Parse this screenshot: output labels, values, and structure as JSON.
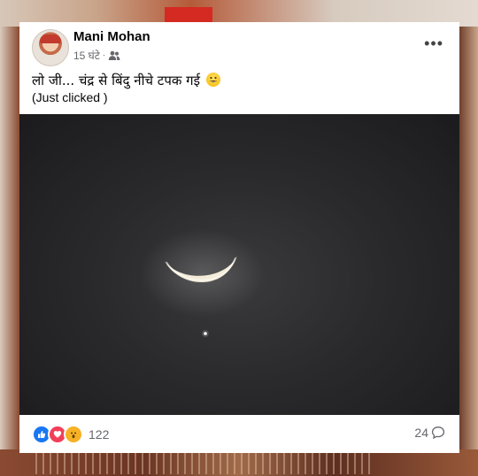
{
  "post": {
    "author": "Mani Mohan",
    "time": "15 घंटे",
    "separator": "·",
    "text": "लो जी... चंद्र से बिंदु नीचे टपक गई",
    "subtext": "(Just clicked )",
    "more_label": "•••"
  },
  "footer": {
    "reaction_count": "122",
    "comment_count": "24"
  },
  "icons": {
    "audience": "friends-icon",
    "emoji": "grinning-face-emoji",
    "comment": "comment-icon",
    "reactions": [
      "like-icon",
      "love-icon",
      "wow-icon"
    ]
  },
  "colors": {
    "like": "#1877f2",
    "love": "#f33e58",
    "wow": "#f7b125",
    "name": "#050505",
    "meta": "#65676b"
  }
}
